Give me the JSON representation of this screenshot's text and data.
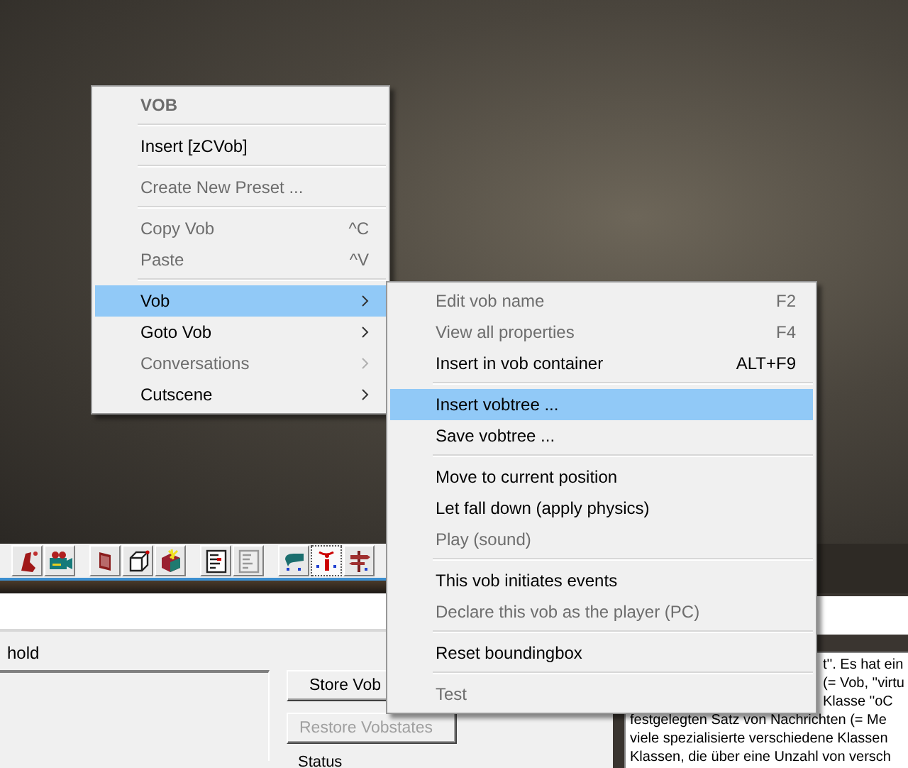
{
  "toolbar": [
    {
      "kind": "footprint",
      "selected": false
    },
    {
      "kind": "camera",
      "selected": false
    },
    {
      "kind": "box",
      "selected": false
    },
    {
      "kind": "cube",
      "selected": false
    },
    {
      "kind": "colored-cube",
      "selected": false
    },
    {
      "kind": "document",
      "selected": false
    },
    {
      "kind": "grey-document",
      "selected": false
    },
    {
      "kind": "person",
      "selected": false
    },
    {
      "kind": "info",
      "selected": true
    },
    {
      "kind": "signpost",
      "selected": false
    }
  ],
  "panel": {
    "label": "hold",
    "buttons": [
      {
        "label": "Store Vob",
        "disabled": false
      },
      {
        "label": "Restore Vobstates",
        "disabled": true
      }
    ],
    "status": "Status"
  },
  "info_text": {
    "lines": [
      {
        "text": "t''. Es hat ein",
        "covered": true
      },
      {
        "text": "(= Vob, ''virtu",
        "covered": true
      },
      {
        "text": "Klasse ''oC",
        "covered": true
      },
      {
        "text": "festgelegten Satz von Nachrichten (= Me",
        "covered": false
      },
      {
        "text": "viele spezialisierte verschiedene Klassen",
        "covered": false
      },
      {
        "text": "Klassen, die über eine Unzahl von versch",
        "covered": false
      }
    ]
  },
  "context_menu": {
    "items": [
      {
        "kind": "header",
        "label": "VOB"
      },
      {
        "kind": "separator"
      },
      {
        "kind": "item",
        "label": "Insert [zCVob]",
        "disabled": false,
        "selected": false,
        "submenu": false
      },
      {
        "kind": "separator"
      },
      {
        "kind": "item",
        "label": "Create New Preset ...",
        "disabled": true,
        "selected": false,
        "submenu": false
      },
      {
        "kind": "separator"
      },
      {
        "kind": "item",
        "label": "Copy Vob",
        "shortcut": "^C",
        "disabled": true,
        "selected": false,
        "submenu": false
      },
      {
        "kind": "item",
        "label": "Paste",
        "shortcut": "^V",
        "disabled": true,
        "selected": false,
        "submenu": false
      },
      {
        "kind": "separator"
      },
      {
        "kind": "item",
        "label": "Vob",
        "disabled": false,
        "selected": true,
        "submenu": true
      },
      {
        "kind": "item",
        "label": "Goto Vob",
        "disabled": false,
        "selected": false,
        "submenu": true
      },
      {
        "kind": "item",
        "label": "Conversations",
        "disabled": true,
        "selected": false,
        "submenu": true
      },
      {
        "kind": "item",
        "label": "Cutscene",
        "disabled": false,
        "selected": false,
        "submenu": true
      }
    ]
  },
  "submenu": {
    "items": [
      {
        "kind": "item",
        "label": "Edit vob name",
        "shortcut": "F2",
        "disabled": true,
        "selected": false,
        "submenu": false
      },
      {
        "kind": "item",
        "label": "View all properties",
        "shortcut": "F4",
        "disabled": true,
        "selected": false,
        "submenu": false
      },
      {
        "kind": "item",
        "label": "Insert in vob container",
        "shortcut": "ALT+F9",
        "disabled": false,
        "selected": false,
        "submenu": false
      },
      {
        "kind": "separator"
      },
      {
        "kind": "item",
        "label": "Insert vobtree ...",
        "disabled": false,
        "selected": true,
        "submenu": false
      },
      {
        "kind": "item",
        "label": "Save vobtree ...",
        "disabled": false,
        "selected": false,
        "submenu": false
      },
      {
        "kind": "separator"
      },
      {
        "kind": "item",
        "label": "Move to current position",
        "disabled": false,
        "selected": false,
        "submenu": false
      },
      {
        "kind": "item",
        "label": "Let fall down (apply physics)",
        "disabled": false,
        "selected": false,
        "submenu": false
      },
      {
        "kind": "item",
        "label": "Play (sound)",
        "disabled": true,
        "selected": false,
        "submenu": false
      },
      {
        "kind": "separator"
      },
      {
        "kind": "item",
        "label": "This vob initiates events",
        "disabled": false,
        "selected": false,
        "submenu": false
      },
      {
        "kind": "item",
        "label": "Declare this vob as the player (PC)",
        "disabled": true,
        "selected": false,
        "submenu": false
      },
      {
        "kind": "separator"
      },
      {
        "kind": "item",
        "label": "Reset boundingbox",
        "disabled": false,
        "selected": false,
        "submenu": false
      },
      {
        "kind": "separator"
      },
      {
        "kind": "item",
        "label": "Test",
        "disabled": true,
        "selected": false,
        "submenu": false
      }
    ]
  }
}
